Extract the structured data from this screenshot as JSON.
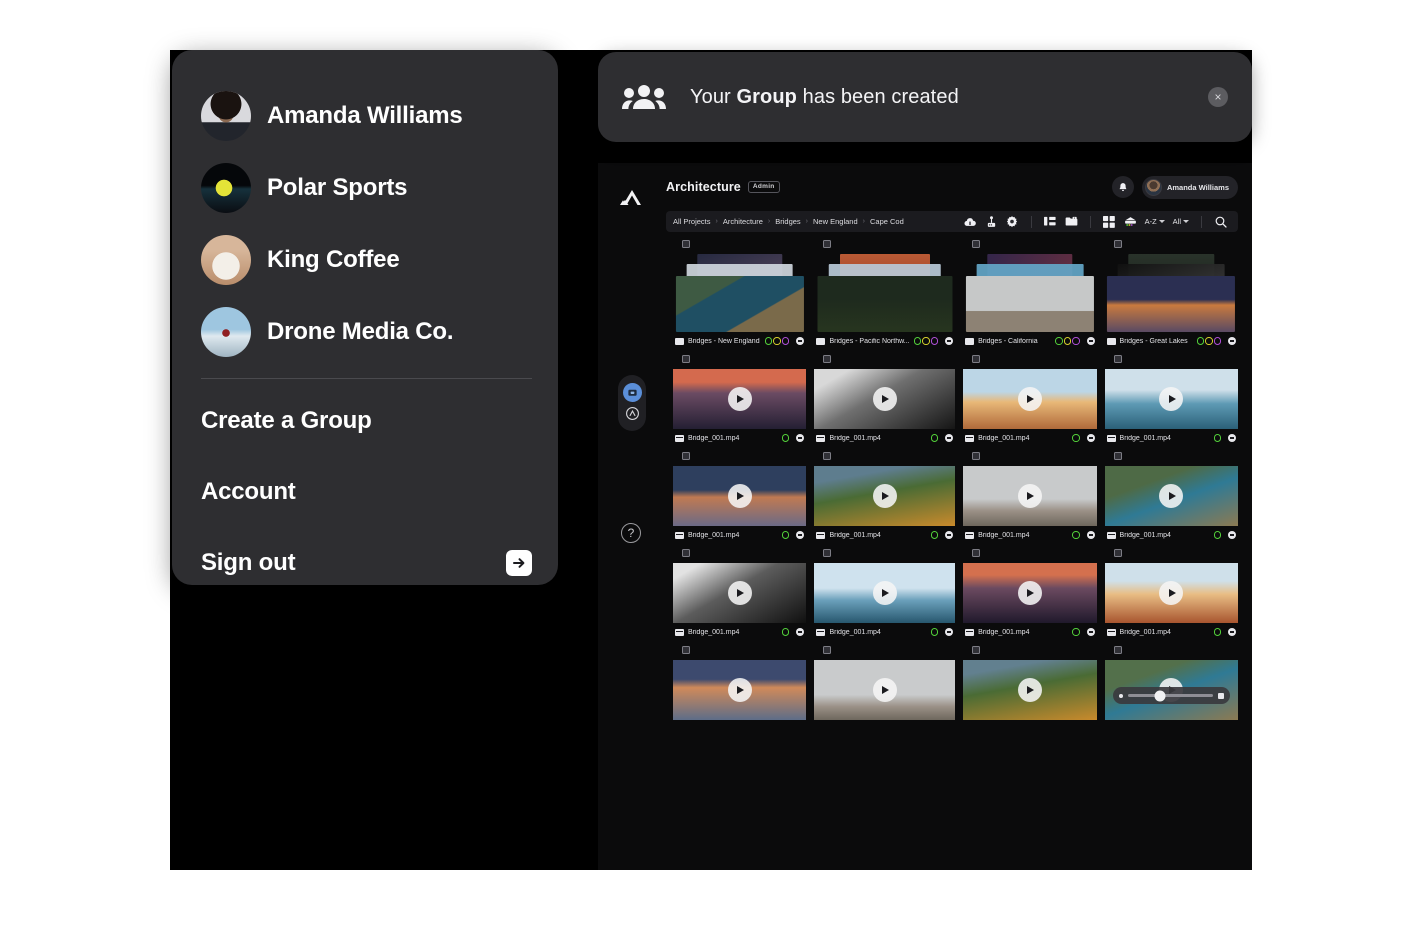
{
  "toast": {
    "icon": "group-people-icon",
    "text_before": "Your ",
    "text_bold": "Group",
    "text_after": " has been created",
    "close_label": "×"
  },
  "account_menu": {
    "groups": [
      {
        "label": "Amanda Williams",
        "avatar": "avatar-amanda"
      },
      {
        "label": "Polar Sports",
        "avatar": "avatar-polar-sports"
      },
      {
        "label": "King Coffee",
        "avatar": "avatar-king-coffee"
      },
      {
        "label": "Drone Media Co.",
        "avatar": "avatar-drone-media"
      }
    ],
    "actions": [
      {
        "label": "Create a Group",
        "icon": "plus-icon"
      },
      {
        "label": "Account",
        "icon": ""
      },
      {
        "label": "Sign out",
        "icon": "sign-out-arrow-icon"
      }
    ]
  },
  "app": {
    "brand": "mountain-logo",
    "sidebar": {
      "items": [
        {
          "name": "projects-icon",
          "active": true
        },
        {
          "name": "connect-icon",
          "active": false
        }
      ],
      "help": "?"
    },
    "header": {
      "project_title": "Architecture",
      "role_badge": "Admin",
      "bell": "bell-icon",
      "user_name": "Amanda Williams"
    },
    "breadcrumb": [
      "All Projects",
      "Architecture",
      "Bridges",
      "New England",
      "Cape Cod"
    ],
    "breadcrumb_separator": "›",
    "toolbar": {
      "icons": [
        "upload-cloud-icon",
        "share-node-icon",
        "settings-gear-icon",
        "tree-view-icon",
        "folder-tag-icon",
        "grid-view-icon",
        "filter-stack-icon"
      ],
      "sort_label": "A-Z",
      "filter_label": "All",
      "search_icon": "search-icon"
    },
    "grid": {
      "rows": [
        {
          "type": "folder",
          "items": [
            {
              "name": "Bridges - New England",
              "dots": [
                "g",
                "y",
                "p"
              ]
            },
            {
              "name": "Bridges - Pacific Northw...",
              "dots": [
                "g",
                "y",
                "p"
              ]
            },
            {
              "name": "Bridges - California",
              "dots": [
                "g",
                "y",
                "p"
              ]
            },
            {
              "name": "Bridges - Great Lakes",
              "dots": [
                "g",
                "y",
                "p"
              ]
            }
          ]
        },
        {
          "type": "video",
          "items": [
            {
              "name": "Bridge_001.mp4",
              "dots": [
                "g"
              ]
            },
            {
              "name": "Bridge_001.mp4",
              "dots": [
                "g"
              ]
            },
            {
              "name": "Bridge_001.mp4",
              "dots": [
                "g"
              ]
            },
            {
              "name": "Bridge_001.mp4",
              "dots": [
                "g"
              ]
            }
          ]
        },
        {
          "type": "video",
          "items": [
            {
              "name": "Bridge_001.mp4",
              "dots": [
                "g"
              ]
            },
            {
              "name": "Bridge_001.mp4",
              "dots": [
                "g"
              ]
            },
            {
              "name": "Bridge_001.mp4",
              "dots": [
                "g"
              ]
            },
            {
              "name": "Bridge_001.mp4",
              "dots": [
                "g"
              ]
            }
          ]
        },
        {
          "type": "video",
          "items": [
            {
              "name": "Bridge_001.mp4",
              "dots": [
                "g"
              ]
            },
            {
              "name": "Bridge_001.mp4",
              "dots": [
                "g"
              ]
            },
            {
              "name": "Bridge_001.mp4",
              "dots": [
                "g"
              ]
            },
            {
              "name": "Bridge_001.mp4",
              "dots": [
                "g"
              ]
            }
          ]
        },
        {
          "type": "video",
          "items": [
            {
              "name": "",
              "dots": []
            },
            {
              "name": "",
              "dots": []
            },
            {
              "name": "",
              "dots": []
            },
            {
              "name": "",
              "dots": [],
              "scrubber": true
            }
          ]
        }
      ]
    }
  },
  "colors": {
    "page_bg": "#ffffff",
    "backdrop": "#000000",
    "panel": "#2e2e31",
    "app_bg": "#0b0b0c",
    "accent_blue": "#5b8fd9",
    "status_green": "#53d13a",
    "status_yellow": "#d8d12c",
    "status_purple": "#b04fd8"
  }
}
